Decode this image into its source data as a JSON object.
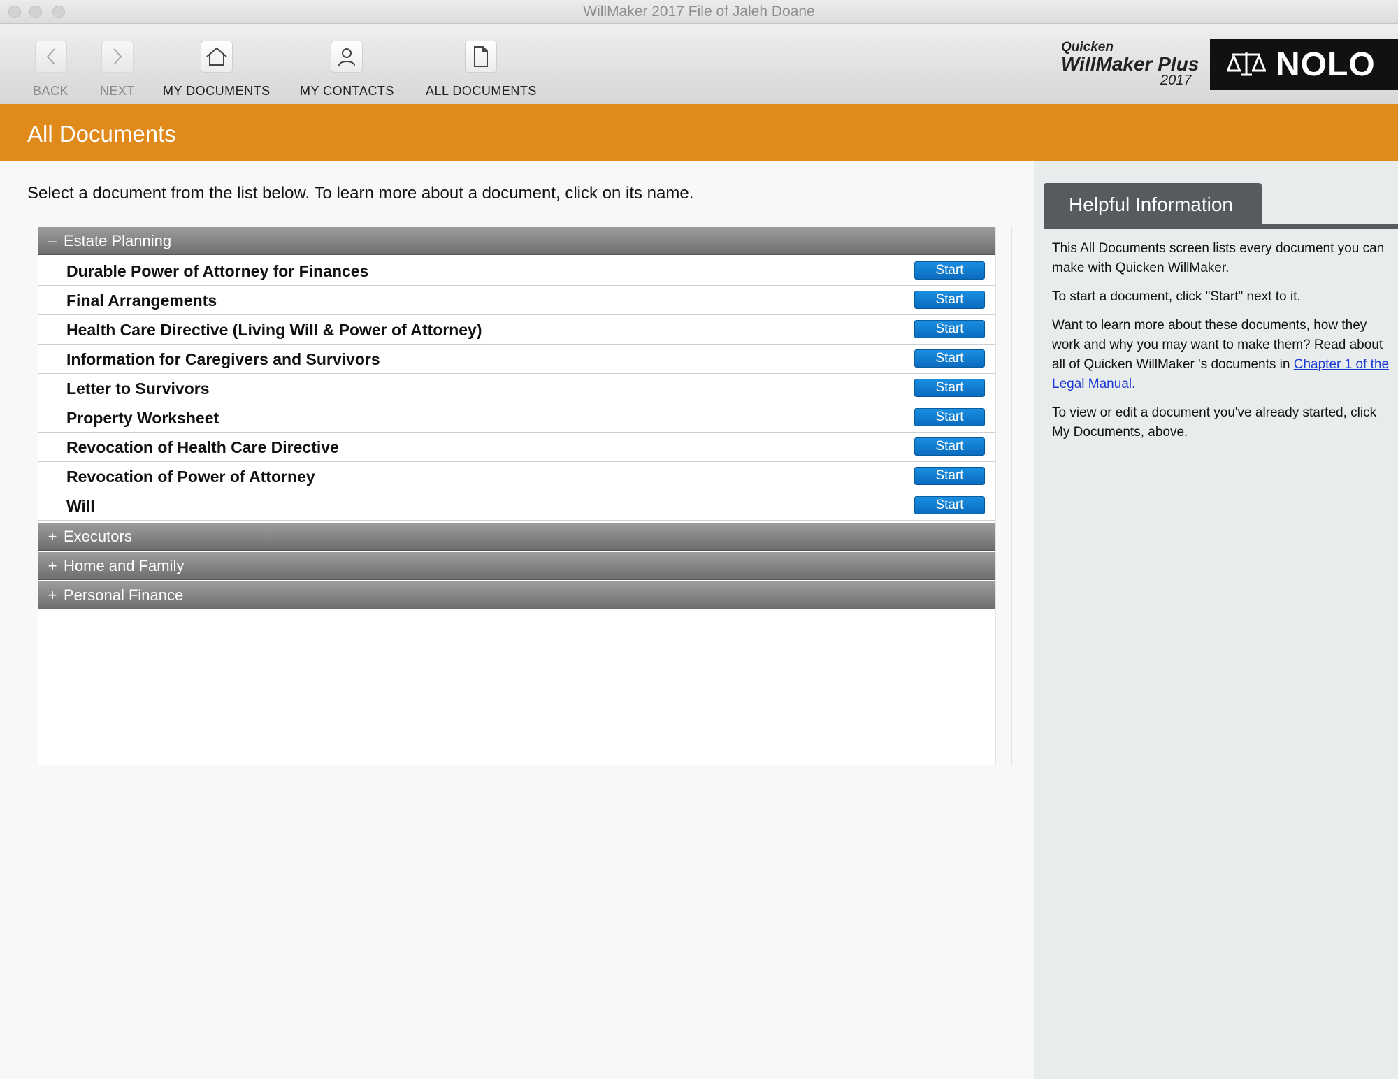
{
  "window": {
    "title": "WillMaker 2017 File of Jaleh Doane"
  },
  "toolbar": {
    "back_label": "BACK",
    "next_label": "NEXT",
    "my_documents_label": "MY DOCUMENTS",
    "my_contacts_label": "MY CONTACTS",
    "all_documents_label": "ALL DOCUMENTS"
  },
  "brand": {
    "quicken": "Quicken",
    "product": "WillMaker Plus",
    "year": "2017",
    "publisher": "NOLO"
  },
  "page": {
    "title": "All Documents",
    "intro": "Select a document from the list below. To learn more about a document, click on its name."
  },
  "categories": [
    {
      "toggle": "–",
      "label": "Estate Planning",
      "documents": [
        {
          "name": "Durable Power of Attorney for Finances",
          "action": "Start"
        },
        {
          "name": "Final Arrangements",
          "action": "Start"
        },
        {
          "name": "Health Care Directive (Living Will & Power of Attorney)",
          "action": "Start"
        },
        {
          "name": "Information for Caregivers and Survivors",
          "action": "Start"
        },
        {
          "name": "Letter to Survivors",
          "action": "Start"
        },
        {
          "name": "Property Worksheet",
          "action": "Start"
        },
        {
          "name": "Revocation of Health Care Directive",
          "action": "Start"
        },
        {
          "name": "Revocation of Power of Attorney",
          "action": "Start"
        },
        {
          "name": "Will",
          "action": "Start"
        }
      ]
    },
    {
      "toggle": "+",
      "label": "Executors"
    },
    {
      "toggle": "+",
      "label": "Home and Family"
    },
    {
      "toggle": "+",
      "label": "Personal Finance"
    }
  ],
  "help": {
    "tab_label": "Helpful Information",
    "p1": "This All Documents screen lists every document you can make with Quicken WillMaker.",
    "p2": "To start a document, click \"Start\" next to it.",
    "p3_text": "Want to learn more about these documents, how they work and why you may want to make them? Read about all of Quicken WillMaker 's documents in ",
    "p3_link": "Chapter 1 of the Legal Manual.",
    "p4": "To view or edit a document you've already started, click My Documents, above."
  },
  "colors": {
    "header_orange": "#e08a1c",
    "start_button_blue": "#0a7ad0",
    "help_tab_gray": "#555b5e"
  }
}
